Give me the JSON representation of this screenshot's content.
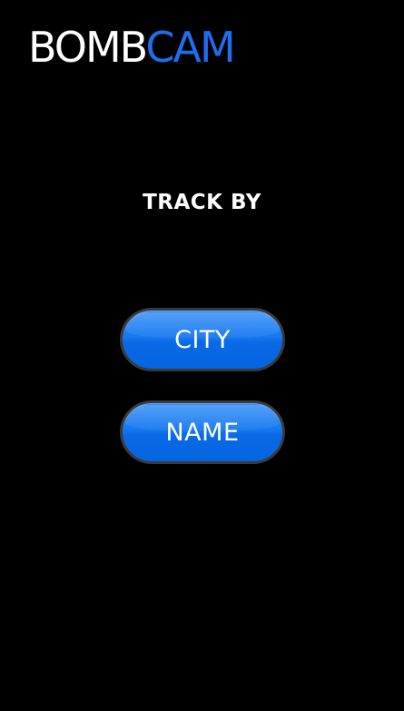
{
  "app": {
    "logo_part_1": "BOMB",
    "logo_part_2": "CAM"
  },
  "main": {
    "heading": "TRACK BY",
    "buttons": [
      {
        "label": "CITY"
      },
      {
        "label": "NAME"
      }
    ]
  },
  "colors": {
    "background": "#000000",
    "accent": "#1f6ef0",
    "button_fill": "#0a6ae6",
    "button_border": "#3a3a3a"
  }
}
